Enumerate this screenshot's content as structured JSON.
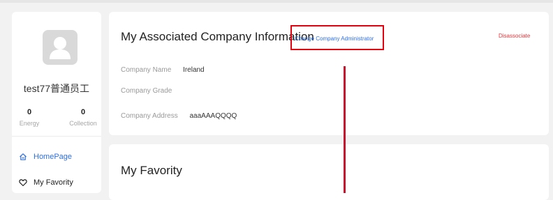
{
  "profile": {
    "username": "test77普通员工",
    "stats": [
      {
        "value": "0",
        "label": "Energy"
      },
      {
        "value": "0",
        "label": "Collection"
      }
    ]
  },
  "nav": [
    {
      "label": "HomePage",
      "icon": "home-icon",
      "active": true
    },
    {
      "label": "My Favority",
      "icon": "heart-icon",
      "active": false
    }
  ],
  "company": {
    "title": "My Associated Company Information",
    "change_admin_label": "Change Company Administrator",
    "disassociate_label": "Disassociate",
    "fields": [
      {
        "label": "Company Name",
        "value": "Ireland"
      },
      {
        "label": "Company Grade",
        "value": ""
      },
      {
        "label": "Company Address",
        "value": "aaaAAAQQQQ"
      }
    ]
  },
  "favorites": {
    "title": "My Favority"
  },
  "colors": {
    "accent": "#2f6fe0",
    "danger": "#e3373b",
    "highlight": "#e3000f"
  }
}
